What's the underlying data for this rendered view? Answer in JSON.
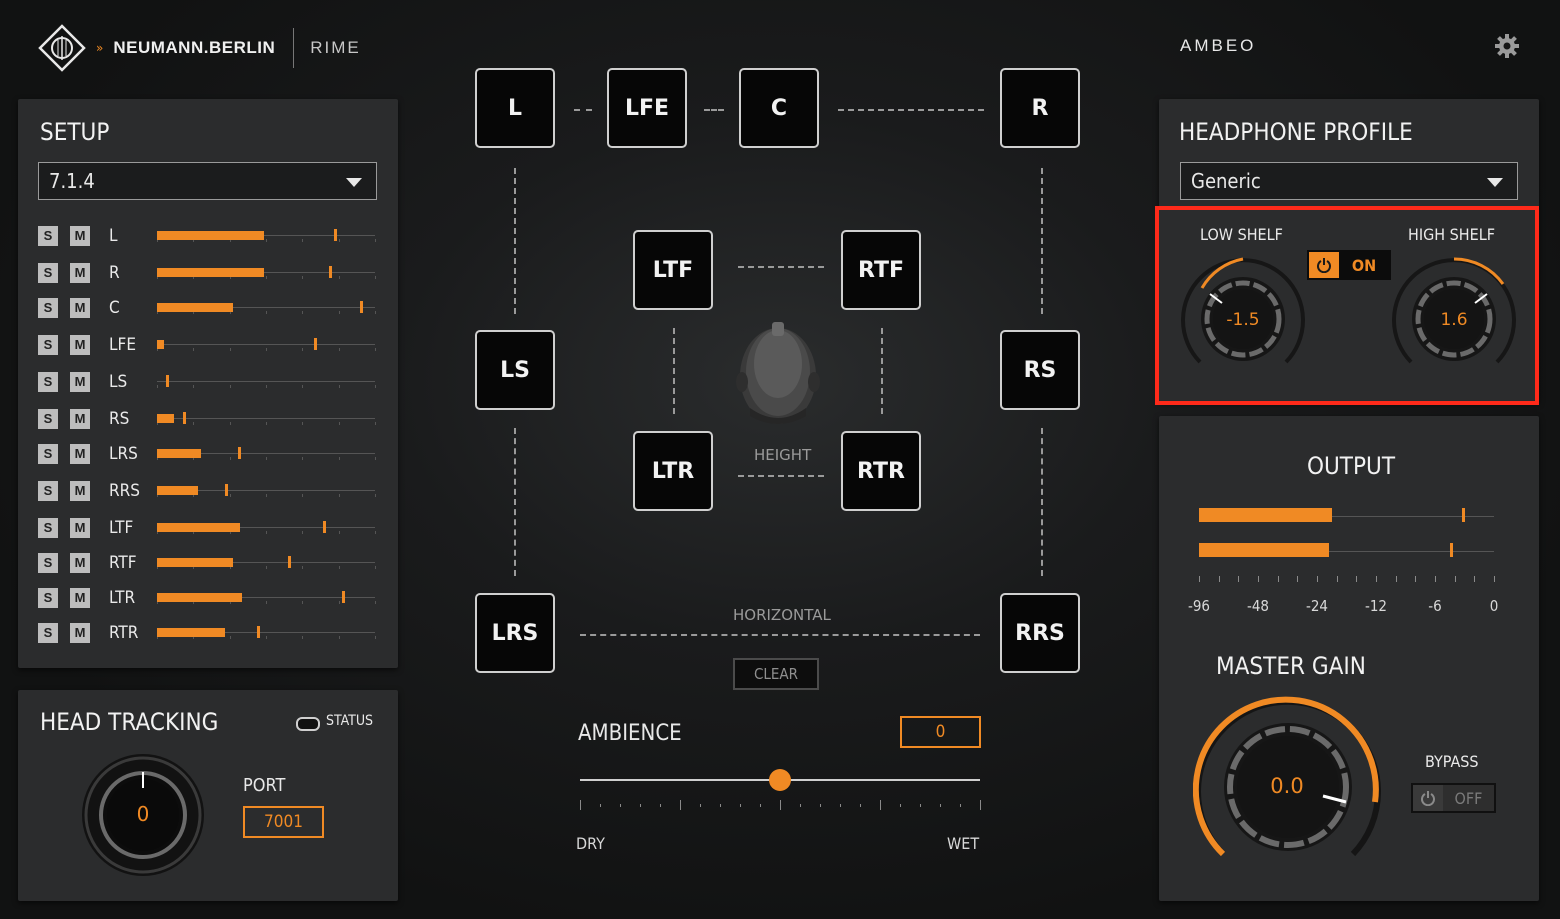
{
  "header": {
    "brand": "NEUMANN.BERLIN",
    "brand_arrows": "»",
    "product": "RIME",
    "right_brand": "AMBEO"
  },
  "setup": {
    "title": "SETUP",
    "format": "7.1.4",
    "solo_label": "S",
    "mute_label": "M",
    "channels": [
      {
        "name": "L",
        "level": 0.49,
        "peak": 0.81
      },
      {
        "name": "R",
        "level": 0.49,
        "peak": 0.79
      },
      {
        "name": "C",
        "level": 0.35,
        "peak": 0.93
      },
      {
        "name": "LFE",
        "level": 0.03,
        "peak": 0.72
      },
      {
        "name": "LS",
        "level": 0.0,
        "peak": 0.04
      },
      {
        "name": "RS",
        "level": 0.08,
        "peak": 0.12
      },
      {
        "name": "LRS",
        "level": 0.2,
        "peak": 0.37
      },
      {
        "name": "RRS",
        "level": 0.19,
        "peak": 0.31
      },
      {
        "name": "LTF",
        "level": 0.38,
        "peak": 0.76
      },
      {
        "name": "RTF",
        "level": 0.35,
        "peak": 0.6
      },
      {
        "name": "LTR",
        "level": 0.39,
        "peak": 0.85
      },
      {
        "name": "RTR",
        "level": 0.31,
        "peak": 0.46
      }
    ]
  },
  "head_tracking": {
    "title": "HEAD TRACKING",
    "status_label": "STATUS",
    "knob_value": "0",
    "port_label": "PORT",
    "port_value": "7001"
  },
  "speakers": {
    "L": "L",
    "LFE": "LFE",
    "C": "C",
    "R": "R",
    "LS": "LS",
    "RS": "RS",
    "LRS": "LRS",
    "RRS": "RRS",
    "LTF": "LTF",
    "RTF": "RTF",
    "LTR": "LTR",
    "RTR": "RTR"
  },
  "labels": {
    "height": "HEIGHT",
    "horizontal": "HORIZONTAL",
    "clear": "CLEAR"
  },
  "ambience": {
    "title": "AMBIENCE",
    "value": "0",
    "position": 0.5,
    "dry": "DRY",
    "wet": "WET"
  },
  "headphone": {
    "title": "HEADPHONE PROFILE",
    "profile": "Generic",
    "low_shelf_label": "LOW SHELF",
    "high_shelf_label": "HIGH SHELF",
    "low_shelf_value": "-1.5",
    "high_shelf_value": "1.6",
    "eq_toggle": "ON"
  },
  "output": {
    "title": "OUTPUT",
    "meters": [
      {
        "level": 0.45,
        "peak": 0.89
      },
      {
        "level": 0.44,
        "peak": 0.85
      }
    ],
    "scale": [
      "-96",
      "-48",
      "-24",
      "-12",
      "-6",
      "0"
    ]
  },
  "master": {
    "title": "MASTER GAIN",
    "value": "0.0",
    "bypass_label": "BYPASS",
    "bypass_state": "OFF"
  },
  "colors": {
    "accent": "#f08a24",
    "highlight": "#ff2a1a"
  }
}
